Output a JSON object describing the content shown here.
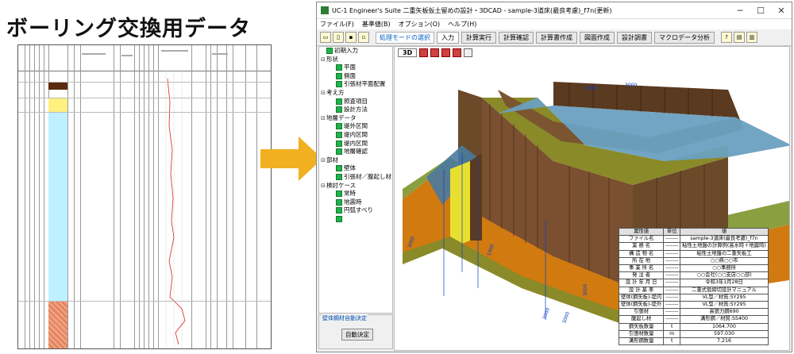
{
  "heading": "ボーリング交換用データ",
  "window": {
    "title": "UC-1 Engineer's Suite 二重矢板仮土留めの設計・3DCAD - sample-3道床(最良考慮)_f7n(更新)",
    "controls": [
      "─",
      "☐",
      "✕"
    ]
  },
  "menu": [
    "ファイル(F)",
    "基準値(B)",
    "オプション(O)",
    "ヘルプ(H)"
  ],
  "toolbar": {
    "mode_label": "処理モードの選択",
    "tabs": [
      "入力",
      "計算実行",
      "計算確認",
      "計算書作成",
      "図面作成",
      "設計調書",
      "マクロデータ分析"
    ]
  },
  "tree": [
    {
      "label": "初期入力",
      "level": 0,
      "chk": true,
      "exp": ""
    },
    {
      "label": "形状",
      "level": 0,
      "chk": false,
      "exp": "⊟"
    },
    {
      "label": "平面",
      "level": 1,
      "chk": true,
      "exp": ""
    },
    {
      "label": "側面",
      "level": 1,
      "chk": true,
      "exp": ""
    },
    {
      "label": "引張材平面配置",
      "level": 1,
      "chk": true,
      "exp": ""
    },
    {
      "label": "考え方",
      "level": 0,
      "chk": false,
      "exp": "⊟"
    },
    {
      "label": "照査項目",
      "level": 1,
      "chk": true,
      "exp": ""
    },
    {
      "label": "設計方法",
      "level": 1,
      "chk": true,
      "exp": ""
    },
    {
      "label": "地層データ",
      "level": 0,
      "chk": false,
      "exp": "⊟"
    },
    {
      "label": "堤外区間",
      "level": 1,
      "chk": true,
      "exp": ""
    },
    {
      "label": "堤内区間",
      "level": 1,
      "chk": true,
      "exp": ""
    },
    {
      "label": "堤内区間",
      "level": 1,
      "chk": true,
      "exp": ""
    },
    {
      "label": "地層確認",
      "level": 1,
      "chk": true,
      "exp": ""
    },
    {
      "label": "部材",
      "level": 0,
      "chk": false,
      "exp": "⊟"
    },
    {
      "label": "壁体",
      "level": 1,
      "chk": true,
      "exp": ""
    },
    {
      "label": "引張材／腹起し材",
      "level": 1,
      "chk": true,
      "exp": ""
    },
    {
      "label": "検討ケース",
      "level": 0,
      "chk": false,
      "exp": "⊟"
    },
    {
      "label": "常時",
      "level": 1,
      "chk": true,
      "exp": ""
    },
    {
      "label": "地震時",
      "level": 1,
      "chk": true,
      "exp": ""
    },
    {
      "label": "円弧すべり",
      "level": 1,
      "chk": true,
      "exp": ""
    },
    {
      "label": "",
      "level": 1,
      "chk": true,
      "exp": ""
    }
  ],
  "auto_panel": {
    "label": "壁体鋼材自動決定",
    "button": "自動決定"
  },
  "view": {
    "tab": "3D"
  },
  "dims": [
    "3000",
    "3000",
    "3000",
    "1000",
    "3000",
    "3000",
    "3000"
  ],
  "info_table": {
    "headers": [
      "属性値",
      "単位",
      "値"
    ],
    "rows": [
      [
        "ファイル名",
        "-------",
        "sample-3道床(最良考慮)_f7n"
      ],
      [
        "業 務 名",
        "-------",
        "粘性土地盤の計算例(高水時＋地震時)"
      ],
      [
        "構 造 物 名",
        "-------",
        "粘性土地盤の二重矢板工"
      ],
      [
        "所 在 地",
        "-------",
        "○○県○○市"
      ],
      [
        "事 業 所 名",
        "-------",
        "○○事務所"
      ],
      [
        "発 注 者",
        "-------",
        "○○会社(○○支店○○部)"
      ],
      [
        "設 計 年 月 日",
        "-------",
        "令和3年1月28日"
      ],
      [
        "設 計 基 準",
        "-------",
        "二重式仮締切設計マニュアル"
      ],
      [
        "壁体(鋼矢板)-堤内",
        "-------",
        "VL型／材質:SY295"
      ],
      [
        "壁体(鋼矢板)-堤外",
        "-------",
        "VL型／材質:SY295"
      ],
      [
        "引張材",
        "-------",
        "高張力鋼690"
      ],
      [
        "腹起し材",
        "-------",
        "溝形鋼／材質:SS400"
      ],
      [
        "鋼矢板数量",
        "t",
        "1064.700"
      ],
      [
        "引張材数量",
        "m",
        "597.030"
      ],
      [
        "溝形鋼数量",
        "t",
        "7.216"
      ]
    ]
  },
  "colors": {
    "ground_gray": "#5a8aa8",
    "sheet_pile": "#6b4a2a",
    "soil_olive": "#7a7a20",
    "soil_orange": "#d07a10",
    "soil_green": "#8aa040",
    "arrow": "#f0b020",
    "tree_check": "#22b14c",
    "log_dark": "#5a2a10",
    "log_yellow": "#fff080",
    "log_cyan": "#bff0ff",
    "log_salmon": "#f0a080"
  }
}
